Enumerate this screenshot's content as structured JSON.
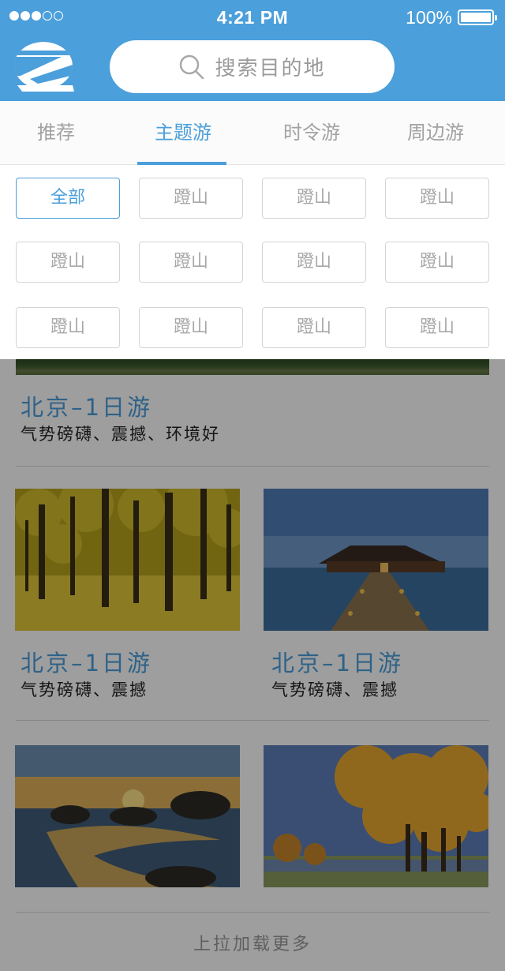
{
  "status_bar": {
    "signal_dots": [
      true,
      true,
      true,
      false,
      false
    ],
    "time": "4:21 PM",
    "battery_percent": "100%",
    "battery_level": 1.0
  },
  "header": {
    "logo_icon": "brand-logo-icon",
    "search": {
      "placeholder": "搜索目的地",
      "icon": "search-icon"
    }
  },
  "tabs": [
    {
      "label": "推荐",
      "active": false
    },
    {
      "label": "主题游",
      "active": true
    },
    {
      "label": "时令游",
      "active": false
    },
    {
      "label": "周边游",
      "active": false
    }
  ],
  "filter": {
    "chips": [
      {
        "label": "全部",
        "active": true
      },
      {
        "label": "蹬山",
        "active": false
      },
      {
        "label": "蹬山",
        "active": false
      },
      {
        "label": "蹬山",
        "active": false
      },
      {
        "label": "蹬山",
        "active": false
      },
      {
        "label": "蹬山",
        "active": false
      },
      {
        "label": "蹬山",
        "active": false
      },
      {
        "label": "蹬山",
        "active": false
      },
      {
        "label": "蹬山",
        "active": false
      },
      {
        "label": "蹬山",
        "active": false
      },
      {
        "label": "蹬山",
        "active": false
      },
      {
        "label": "蹬山",
        "active": false
      }
    ]
  },
  "featured": {
    "title": "北京–1日游",
    "desc": "气势磅礴、震撼、环境好"
  },
  "cards": [
    {
      "title": "北京–1日游",
      "desc": "气势磅礴、震撼",
      "image": "ginkgo-forest"
    },
    {
      "title": "北京–1日游",
      "desc": "气势磅礴、震撼",
      "image": "water-villa-pier"
    },
    {
      "image": "beach-sunset-rocks"
    },
    {
      "image": "autumn-poplar-trees"
    }
  ],
  "load_more": "上拉加载更多",
  "colors": {
    "accent": "#4b9fdb",
    "header_bg": "#4b9fdb",
    "overlay": "rgba(0,0,0,0.38)"
  }
}
